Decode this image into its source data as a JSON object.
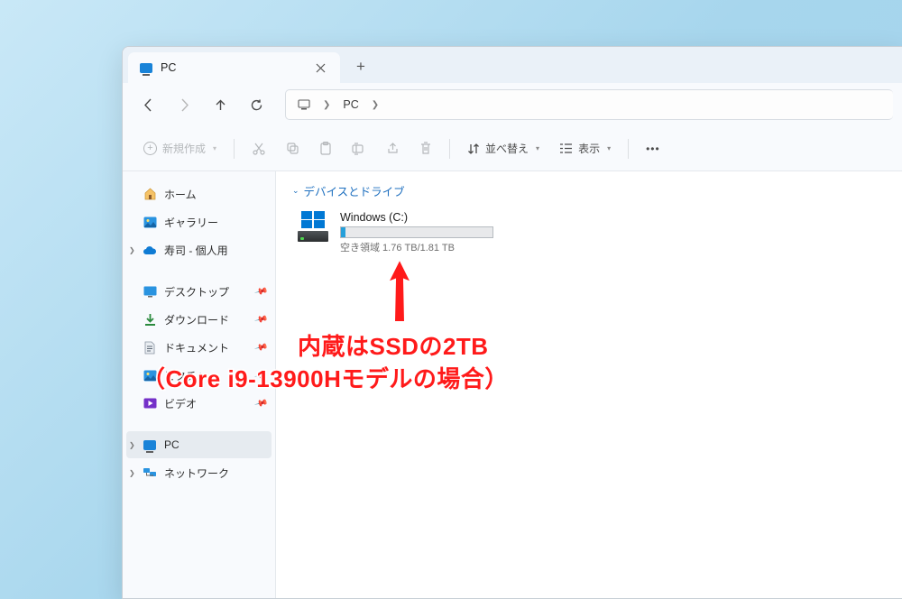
{
  "tab": {
    "icon": "monitor-icon",
    "title": "PC"
  },
  "breadcrumb": {
    "segments": [
      "PC"
    ]
  },
  "toolbar": {
    "new_label": "新規作成",
    "sort_label": "並べ替え",
    "view_label": "表示"
  },
  "sidebar": {
    "home": "ホーム",
    "gallery": "ギャラリー",
    "personal": "寿司 - 個人用",
    "desktop": "デスクトップ",
    "downloads": "ダウンロード",
    "documents": "ドキュメント",
    "pictures": "ピクチャ",
    "videos": "ビデオ",
    "pc": "PC",
    "network": "ネットワーク"
  },
  "content": {
    "group_header": "デバイスとドライブ",
    "drive": {
      "name": "Windows (C:)",
      "free_label": "空き領域 1.76 TB/1.81 TB",
      "fill_percent": 3
    }
  },
  "annotation": {
    "line1": "内蔵はSSDの2TB",
    "line2": "（Core i9-13900Hモデルの場合）"
  },
  "colors": {
    "accent": "#0078d4",
    "annotation": "#ff1a1a"
  }
}
